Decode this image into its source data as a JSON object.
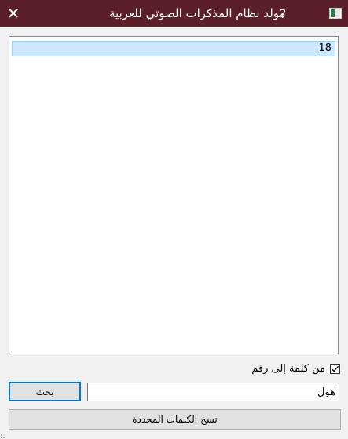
{
  "window": {
    "title": "مولد نظام المذكرات الصوتي للعربية",
    "help_glyph": "?",
    "close_glyph": "✕",
    "titlebar_color": "#5a1f2b"
  },
  "results": {
    "items": [
      "18"
    ],
    "selected_index": 0
  },
  "options": {
    "word_to_number_label": "من كلمة إلى رقم",
    "word_to_number_checked": true
  },
  "search": {
    "value": "هول",
    "button_label": "بحث"
  },
  "actions": {
    "copy_label": "نسخ الكلمات المحددة"
  },
  "colors": {
    "selection_bg": "#cce8ff",
    "focus_border": "#0078d7"
  }
}
